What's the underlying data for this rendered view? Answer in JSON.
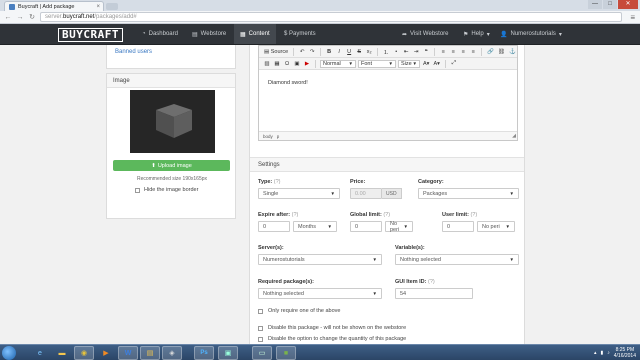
{
  "browser": {
    "tab_title": "Buycraft | Add package",
    "tab_close": "×",
    "url_scheme": "server.",
    "url_host": "buycraft.net",
    "url_path": "/packages/add#",
    "window_buttons": [
      "—",
      "□",
      "✕"
    ]
  },
  "navbar": {
    "logo": "BUYCRAFT",
    "links": [
      {
        "label": "Dashboard",
        "icon": "dashboard-icon"
      },
      {
        "label": "Webstore",
        "icon": "shop-icon"
      },
      {
        "label": "Content",
        "icon": "content-icon"
      },
      {
        "label": "$ Payments",
        "icon": "payments-icon"
      },
      {
        "label": "Visit Webstore",
        "icon": "share-icon"
      },
      {
        "label": "Help",
        "icon": "help-icon"
      },
      {
        "label": "Numerostutorials",
        "icon": "user-icon"
      }
    ]
  },
  "sidebar": {
    "banned_link": "Banned users",
    "image_heading": "Image",
    "upload_button": "Upload image",
    "recommended_size": "Recommended size 190x165px",
    "hide_border_label": "Hide the image border"
  },
  "editor": {
    "source_label": "Source",
    "format_label": "Normal",
    "font_label": "Font",
    "size_label": "Size",
    "content": "Diamond sword!",
    "path": [
      "body",
      "p"
    ]
  },
  "settings": {
    "heading": "Settings",
    "type": {
      "label": "Type:",
      "hint": "(?)",
      "value": "Single"
    },
    "price": {
      "label": "Price:",
      "placeholder": "0.00",
      "currency": "USD"
    },
    "category": {
      "label": "Category:",
      "value": "Packages"
    },
    "expire_after": {
      "label": "Expire after:",
      "hint": "(?)",
      "value": "0",
      "unit": "Months"
    },
    "global_limit": {
      "label": "Global limit:",
      "hint": "(?)",
      "value": "0",
      "period": "No peri"
    },
    "user_limit": {
      "label": "User limit:",
      "hint": "(?)",
      "value": "0",
      "period": "No peri"
    },
    "servers": {
      "label": "Server(s):",
      "value": "Numerostutorials"
    },
    "variables": {
      "label": "Variable(s):",
      "value": "Nothing selected"
    },
    "required_packages": {
      "label": "Required package(s):",
      "value": "Nothing selected"
    },
    "gui_item_id": {
      "label": "GUI Item ID:",
      "hint": "(?)",
      "value": "54"
    },
    "only_require_one": "Only require one of the above",
    "disable_package": "Disable this package - will not be shown on the webstore",
    "disable_quantity": "Disable the option to change the quantity of this package"
  },
  "taskbar": {
    "apps": [
      "ie-icon",
      "explorer-icon",
      "chrome-icon",
      "media-icon",
      "word-icon",
      "explorer2-icon",
      "app-icon",
      "photoshop-icon",
      "app2-icon",
      "screen-icon",
      "minecraft-icon"
    ],
    "time": "8:25 PM",
    "date": "4/16/2014"
  },
  "colors": {
    "navbar_bg": "#2f3338",
    "upload_green": "#5cb85c",
    "link_blue": "#3a78c2"
  }
}
